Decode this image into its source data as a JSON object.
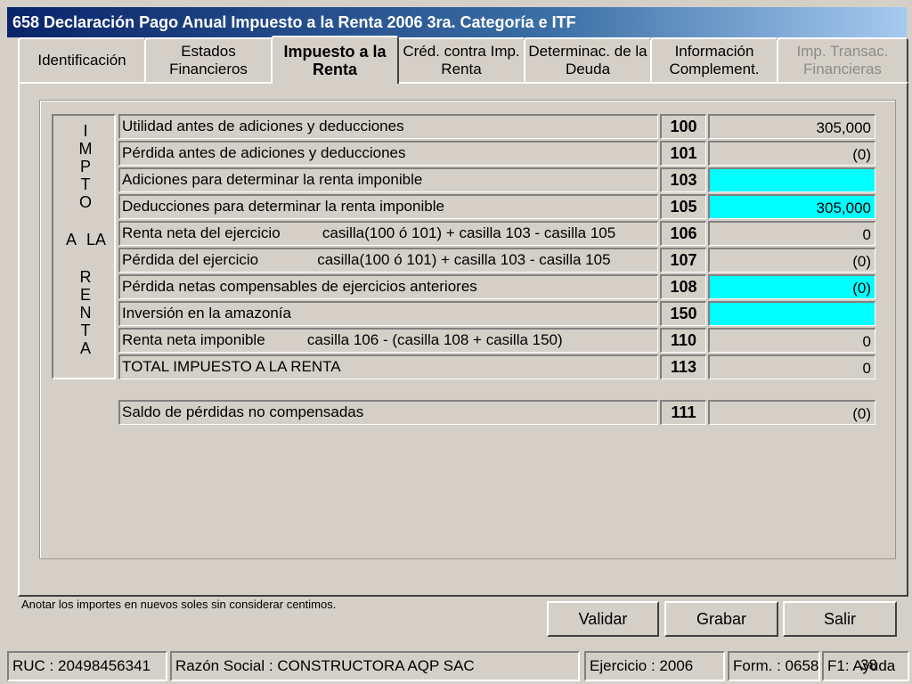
{
  "window": {
    "title": "658 Declaración Pago Anual Impuesto a la Renta 2006 3ra. Categoría e ITF"
  },
  "tabs": [
    {
      "label": "Identificación"
    },
    {
      "label": "Estados\nFinancieros"
    },
    {
      "label": "Impuesto a  la\nRenta"
    },
    {
      "label": "Créd. contra Imp.\nRenta"
    },
    {
      "label": "Determinac. de la\nDeuda"
    },
    {
      "label": "Información\nComplement."
    },
    {
      "label": "Imp. Transac.\nFinancieras"
    }
  ],
  "side_label": {
    "letters": [
      "I",
      "M",
      "P",
      "T",
      "O",
      "A",
      "LA",
      "R",
      "E",
      "N",
      "T",
      "A"
    ]
  },
  "rows": [
    {
      "label": "Utilidad antes de adiciones y deducciones",
      "code": "100",
      "value": "305,000"
    },
    {
      "label": "Pérdida antes de adiciones y deducciones",
      "code": "101",
      "value": "(0)"
    },
    {
      "label": "Adiciones para determinar la renta imponible",
      "code": "103",
      "value": ""
    },
    {
      "label": "Deducciones para determinar la renta imponible",
      "code": "105",
      "value": "305,000"
    },
    {
      "label": "Renta neta del ejercicio          casilla(100 ó 101) + casilla 103 - casilla 105",
      "code": "106",
      "value": "0"
    },
    {
      "label": "Pérdida del ejercicio              casilla(100 ó 101) + casilla 103 - casilla 105",
      "code": "107",
      "value": "(0)"
    },
    {
      "label": "Pérdida netas compensables de ejercicios anteriores",
      "code": "108",
      "value": "(0)"
    },
    {
      "label": "Inversión en la amazonía",
      "code": "150",
      "value": ""
    },
    {
      "label": "Renta neta imponible          casilla 106 - (casilla 108 + casilla 150)",
      "code": "110",
      "value": "0"
    },
    {
      "label": "TOTAL IMPUESTO A LA RENTA",
      "code": "113",
      "value": "0"
    },
    {
      "label": "Saldo de pérdidas no compensadas",
      "code": "111",
      "value": "(0)"
    }
  ],
  "note": "Anotar los importes en nuevos soles sin considerar centimos.",
  "buttons": {
    "validar": "Validar",
    "grabar": "Grabar",
    "salir": "Salir"
  },
  "status": {
    "ruc": "RUC : 20498456341",
    "razon_social": "Razón Social : CONSTRUCTORA AQP SAC",
    "ejercicio": "Ejercicio : 2006",
    "form": "Form. : 0658",
    "ayuda": "F1: Ayuda",
    "page_number": "38"
  },
  "colors": {
    "editable_field": "#00ffff",
    "window_face": "#d4d0c8",
    "titlebar_start": "#0a246a"
  }
}
